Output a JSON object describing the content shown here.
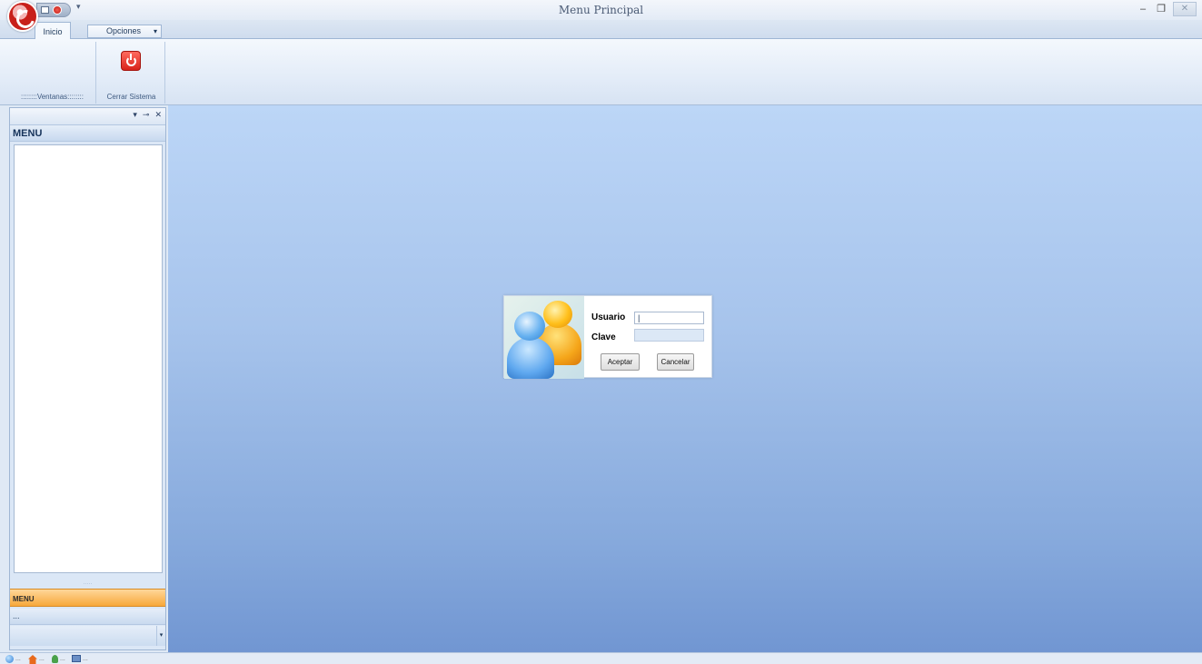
{
  "window": {
    "title": "Menu Principal",
    "controls": {
      "minimize": "–",
      "maximize": "❐",
      "close": "✕"
    }
  },
  "quick_access": {
    "dropdown": "▾"
  },
  "ribbon": {
    "tabs": [
      {
        "label": "Inicio",
        "active": true
      },
      {
        "label": "Opciones",
        "dropdown": "▾"
      }
    ],
    "groups": [
      {
        "label": "::::::::Ventanas::::::::"
      },
      {
        "label": "Cerrar Sistema"
      }
    ]
  },
  "dock": {
    "controls": {
      "dropdown": "▾",
      "pin": "⊸",
      "close": "✕"
    },
    "menu_header": "MENU",
    "splitter": "·····",
    "bars": [
      {
        "label": "MENU",
        "active": true
      },
      {
        "label": "..."
      },
      {
        "label": "",
        "dropdown": "▾"
      }
    ]
  },
  "login": {
    "usuario_label": "Usuario",
    "usuario_value": "|",
    "clave_label": "Clave",
    "clave_value": "",
    "accept_label": "Aceptar",
    "cancel_label": "Cancelar"
  },
  "statusbar": {
    "icons": [
      "globe-icon",
      "home-icon",
      "user-icon",
      "computer-icon"
    ],
    "separator": "..."
  },
  "colors": {
    "app_icon": "#c8201a",
    "menu_bar_active": "#f7a83b",
    "main_background_top": "#bcd6f7",
    "main_background_bottom": "#7196d2"
  }
}
